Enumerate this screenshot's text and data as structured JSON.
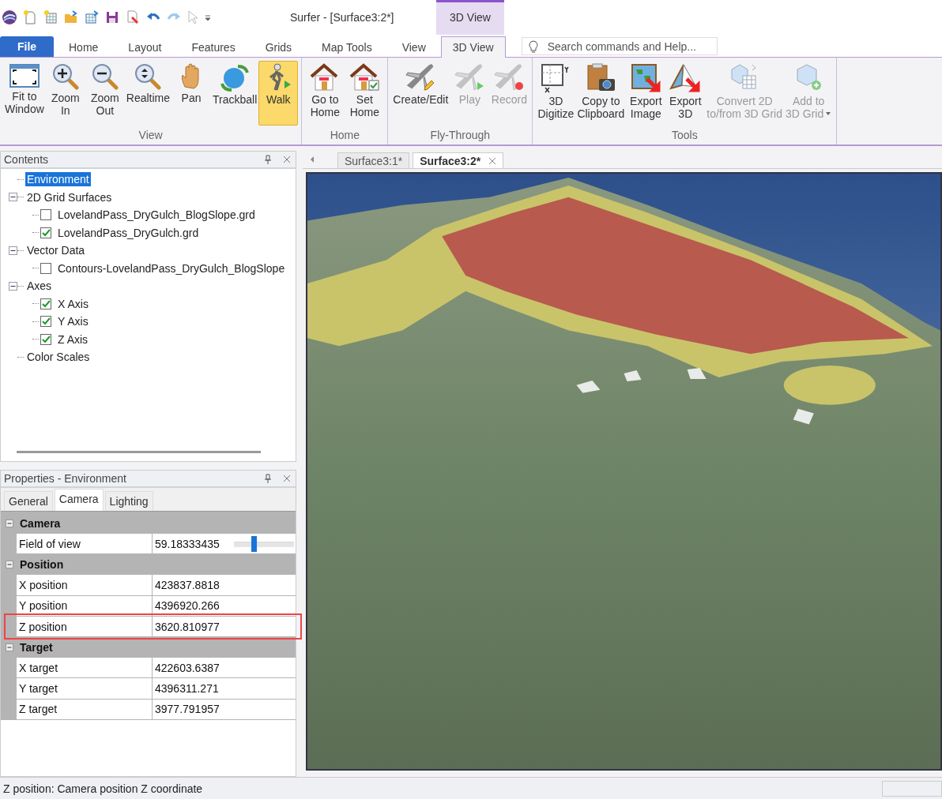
{
  "title_bar": {
    "title": "Surfer - [Surface3:2*]",
    "contextual_tab": "3D View"
  },
  "ribbon_tabs": [
    {
      "label": "File",
      "kind": "file",
      "selected": false
    },
    {
      "label": "Home",
      "kind": "tab",
      "selected": false
    },
    {
      "label": "Layout",
      "kind": "tab",
      "selected": false
    },
    {
      "label": "Features",
      "kind": "tab",
      "selected": false
    },
    {
      "label": "Grids",
      "kind": "tab",
      "selected": false
    },
    {
      "label": "Map Tools",
      "kind": "tab",
      "selected": false
    },
    {
      "label": "View",
      "kind": "tab",
      "selected": false
    },
    {
      "label": "3D View",
      "kind": "tab",
      "selected": true
    }
  ],
  "search": {
    "placeholder": "Search commands and Help..."
  },
  "ribbon_groups": [
    {
      "label": "View",
      "buttons": [
        {
          "lines": [
            "Fit to",
            "Window"
          ],
          "selected": false,
          "disabled": false
        },
        {
          "lines": [
            "Zoom",
            "In"
          ],
          "selected": false,
          "disabled": false
        },
        {
          "lines": [
            "Zoom",
            "Out"
          ],
          "selected": false,
          "disabled": false
        },
        {
          "lines": [
            "Realtime"
          ],
          "selected": false,
          "disabled": false
        },
        {
          "lines": [
            "Pan"
          ],
          "selected": false,
          "disabled": false
        },
        {
          "lines": [
            "Trackball"
          ],
          "selected": false,
          "disabled": false
        },
        {
          "lines": [
            "Walk"
          ],
          "selected": true,
          "disabled": false
        }
      ]
    },
    {
      "label": "Home",
      "buttons": [
        {
          "lines": [
            "Go to",
            "Home"
          ],
          "selected": false,
          "disabled": false
        },
        {
          "lines": [
            "Set",
            "Home"
          ],
          "selected": false,
          "disabled": false
        }
      ]
    },
    {
      "label": "Fly-Through",
      "buttons": [
        {
          "lines": [
            "Create/Edit"
          ],
          "selected": false,
          "disabled": false
        },
        {
          "lines": [
            "Play"
          ],
          "selected": false,
          "disabled": true
        },
        {
          "lines": [
            "Record"
          ],
          "selected": false,
          "disabled": true
        }
      ]
    },
    {
      "label": "Tools",
      "buttons": [
        {
          "lines": [
            "3D",
            "Digitize"
          ],
          "selected": false,
          "disabled": false
        },
        {
          "lines": [
            "Copy to",
            "Clipboard"
          ],
          "selected": false,
          "disabled": false
        },
        {
          "lines": [
            "Export",
            "Image"
          ],
          "selected": false,
          "disabled": false
        },
        {
          "lines": [
            "Export",
            "3D"
          ],
          "selected": false,
          "disabled": false
        },
        {
          "lines": [
            "Convert 2D",
            "to/from 3D Grid"
          ],
          "selected": false,
          "disabled": true
        },
        {
          "lines": [
            "Add to",
            "3D Grid"
          ],
          "selected": false,
          "disabled": true,
          "dropdown": true
        }
      ]
    }
  ],
  "contents": {
    "title": "Contents",
    "tree": [
      {
        "label": "Environment",
        "kind": "item",
        "selected": true
      },
      {
        "label": "2D Grid Surfaces",
        "kind": "group",
        "expanded": true,
        "selected": false,
        "children": [
          {
            "label": "LovelandPass_DryGulch_BlogSlope.grd",
            "kind": "layer",
            "checked": false,
            "selected": false
          },
          {
            "label": "LovelandPass_DryGulch.grd",
            "kind": "layer",
            "checked": true,
            "selected": false
          }
        ]
      },
      {
        "label": "Vector Data",
        "kind": "group",
        "expanded": true,
        "selected": false,
        "children": [
          {
            "label": "Contours-LovelandPass_DryGulch_BlogSlope",
            "kind": "layer",
            "checked": false,
            "selected": false
          }
        ]
      },
      {
        "label": "Axes",
        "kind": "group",
        "expanded": true,
        "selected": false,
        "children": [
          {
            "label": "X Axis",
            "kind": "layer",
            "checked": true,
            "selected": false
          },
          {
            "label": "Y Axis",
            "kind": "layer",
            "checked": true,
            "selected": false
          },
          {
            "label": "Z Axis",
            "kind": "layer",
            "checked": true,
            "selected": false
          }
        ]
      },
      {
        "label": "Color Scales",
        "kind": "item",
        "selected": false
      }
    ]
  },
  "properties": {
    "title": "Properties - Environment",
    "tabs": [
      {
        "label": "General",
        "selected": false
      },
      {
        "label": "Camera",
        "selected": true
      },
      {
        "label": "Lighting",
        "selected": false
      }
    ],
    "sections": [
      {
        "title": "Camera",
        "expanded": true,
        "rows": [
          {
            "label": "Field of view",
            "value": "59.18333435",
            "kind": "slider",
            "level": 0.33,
            "highlighted": false
          }
        ]
      },
      {
        "title": "Position",
        "expanded": true,
        "rows": [
          {
            "label": "X position",
            "value": "423837.8818",
            "kind": "text",
            "highlighted": false
          },
          {
            "label": "Y position",
            "value": "4396920.266",
            "kind": "text",
            "highlighted": false
          },
          {
            "label": "Z position",
            "value": "3620.810977",
            "kind": "text",
            "highlighted": true
          }
        ]
      },
      {
        "title": "Target",
        "expanded": true,
        "rows": [
          {
            "label": "X target",
            "value": "422603.6387",
            "kind": "text",
            "highlighted": false
          },
          {
            "label": "Y target",
            "value": "4396311.271",
            "kind": "text",
            "highlighted": false
          },
          {
            "label": "Z target",
            "value": "3977.791957",
            "kind": "text",
            "highlighted": false
          }
        ]
      }
    ]
  },
  "document_tabs": [
    {
      "label": "Surface3:1*",
      "selected": false
    },
    {
      "label": "Surface3:2*",
      "selected": true
    }
  ],
  "status_bar": {
    "text": "Z position: Camera position Z coordinate"
  }
}
